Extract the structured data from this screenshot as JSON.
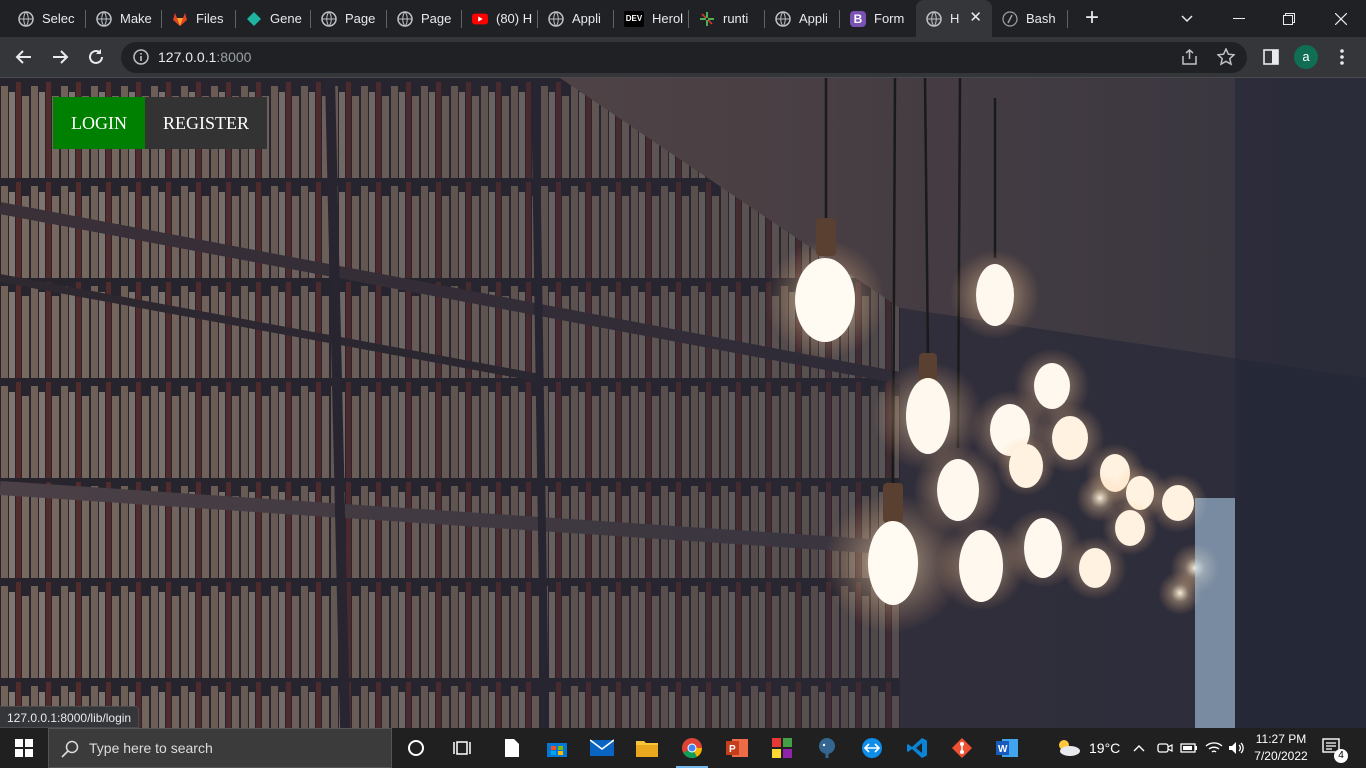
{
  "browser": {
    "tabs": [
      {
        "title": "Selec",
        "icon": "globe-icon"
      },
      {
        "title": "Make",
        "icon": "globe-icon"
      },
      {
        "title": "Files",
        "icon": "gitlab-icon"
      },
      {
        "title": "Gene",
        "icon": "diamond-icon"
      },
      {
        "title": "Page",
        "icon": "globe-icon"
      },
      {
        "title": "Page",
        "icon": "globe-icon"
      },
      {
        "title": "(80) H",
        "icon": "youtube-icon"
      },
      {
        "title": "Appli",
        "icon": "globe-icon"
      },
      {
        "title": "Herol",
        "icon": "dev-icon"
      },
      {
        "title": "runti",
        "icon": "sparkle-icon"
      },
      {
        "title": "Appli",
        "icon": "globe-icon"
      },
      {
        "title": "Form",
        "icon": "bootstrap-icon"
      },
      {
        "title": "H",
        "icon": "globe-icon"
      },
      {
        "title": "Bash",
        "icon": "bash-icon"
      }
    ],
    "favicon_labels": {
      "dev": "DEV",
      "bootstrap": "B"
    },
    "new_tab": "+",
    "url_host": "127.0.0.1",
    "url_port": ":8000",
    "profile_initial": "a"
  },
  "page": {
    "nav": {
      "login": "LOGIN",
      "register": "REGISTER"
    },
    "hover_link_url": "127.0.0.1:8000/lib/login",
    "colors": {
      "login_bg": "#008000",
      "register_bg": "#333333"
    }
  },
  "taskbar": {
    "search_placeholder": "Type here to search",
    "temperature": "19°C",
    "time": "11:27 PM",
    "date": "7/20/2022",
    "notification_count": "4"
  }
}
